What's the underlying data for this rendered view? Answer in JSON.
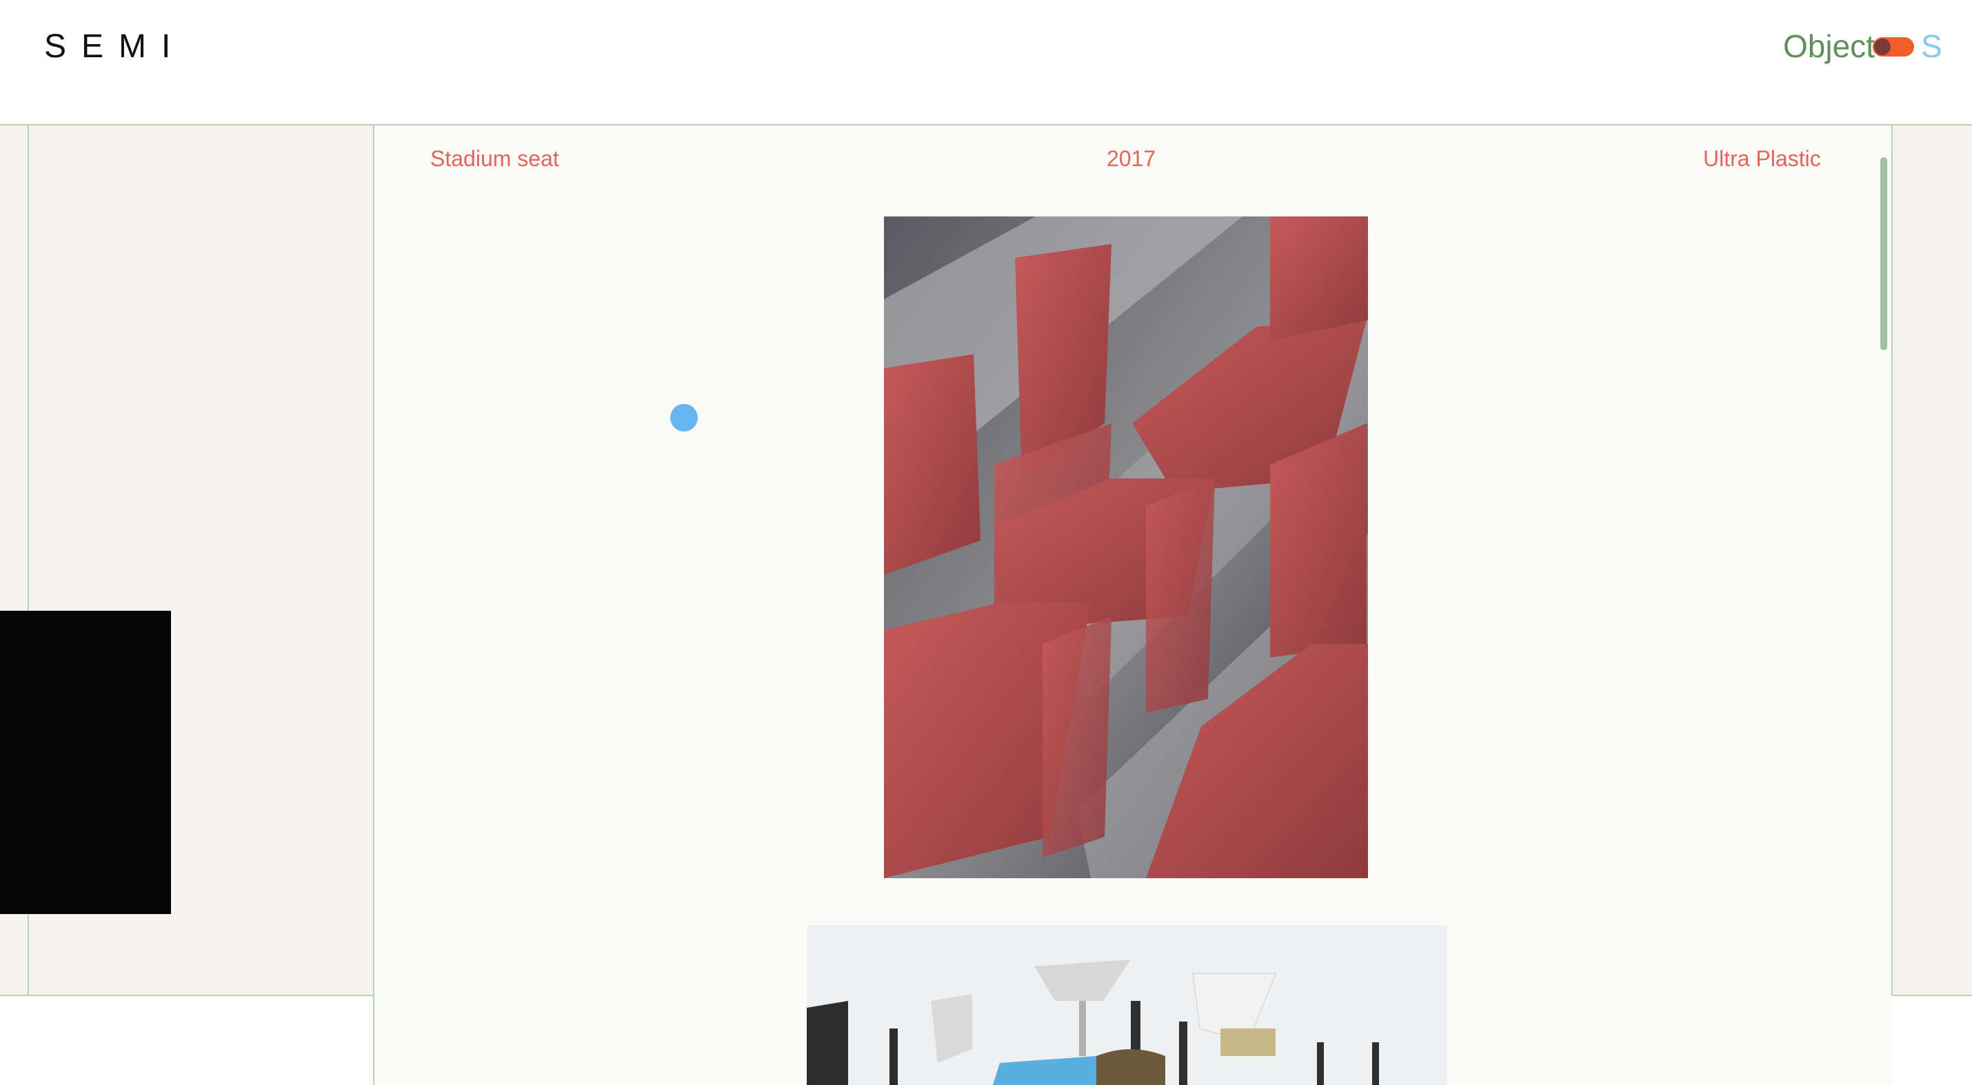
{
  "header": {
    "logo": "SEMI",
    "mode_label": "Object",
    "mode_alt": "S"
  },
  "project": {
    "title": "Stadium seat",
    "year": "2017",
    "material": "Ultra Plastic"
  },
  "images": [
    {
      "name": "stadium-seats-photo",
      "description_icon": "photo-icon"
    },
    {
      "name": "chairs-group-photo",
      "description_icon": "photo-icon"
    }
  ],
  "colors": {
    "accent_green": "#5f8f5a",
    "accent_red": "#e0665a",
    "toggle_orange": "#f25c2a",
    "cursor_blue": "#64b5f0",
    "grid_line": "#b7d3b6"
  }
}
